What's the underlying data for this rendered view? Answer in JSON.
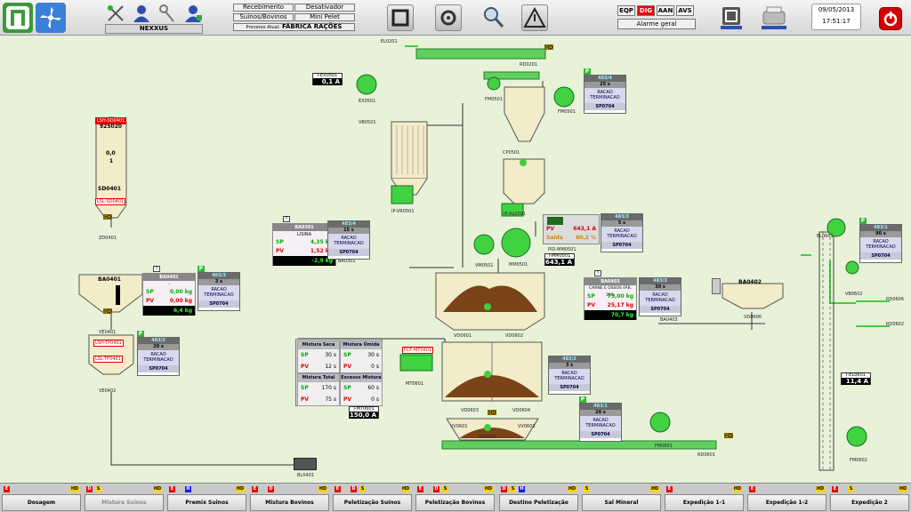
{
  "header": {
    "nexxus_label": "NEXXUS",
    "proc_buttons": [
      "Recebimento",
      "Desativador",
      "Suinos/Bovinos",
      "Mini Pelet"
    ],
    "proc_current_label": "Processo Atual:",
    "proc_current_value": "FÁBRICA RAÇÕES",
    "modes": [
      "EQP",
      "DIG",
      "AAN",
      "AVS"
    ],
    "alarm_label": "Alarme geral",
    "date": "09/05/2013",
    "time": "17:51:17"
  },
  "colors": {
    "machine_green": "#3fcf3f",
    "alarm_red": "#d40000",
    "hd_yellow": "#ffd400",
    "panel_bg": "#e7f2d9"
  },
  "tags": {
    "el0201": "EL0201",
    "rd0201": "RD0201",
    "iex0501": "I-EX0501",
    "iex0501_val": "0,1 A",
    "ex0501": "EX0501",
    "vb0501": "VB0501",
    "fm0501a": "FM0501",
    "fm0501b": "FM0501",
    "cp0501": "CP0501",
    "ipvr0501": "IP-VR0501",
    "ipal0501": "IP-AL0501",
    "vm0501": "VM0501",
    "mm0501": "MM0501",
    "pidmm0501": "PID-MM0501",
    "imm0501": "I-MM0501",
    "imm0501_val": "643,1 A",
    "lshsd0401": "LSH-SD0401",
    "sd_val1": "925020",
    "sd_val2": "0,0",
    "sd_val3": "1",
    "sd0401": "SD0401",
    "lslsd0401": "LSL-SD0401",
    "zd0401": "ZD0401",
    "ba0401_title": "BA0401",
    "ve0401": "VE0401",
    "lshtp0401": "LSH-TP0401",
    "lsltp0401": "LSL-TP0401",
    "ve0402": "VE0402",
    "ba0403_label": "BA0403",
    "ba0402_title": "BA0402",
    "vd0606": "VD0606",
    "el0601": "EL0601",
    "vb0602": "VB0602",
    "rd0606": "RD0606",
    "rd0602": "RD0602",
    "iel0601": "I-EL0601",
    "iel0601_val": "11,4 A",
    "fm0602": "FM0602",
    "vd0601": "VD0601",
    "vd0602": "VD0602",
    "fcfmt0601": "FCF-MT0601",
    "mt0601": "MT0601",
    "vd0603": "VD0603",
    "vd0604": "VD0604",
    "vv0601": "VV0601",
    "vv0602": "VV0602",
    "vv0603": "VV0603",
    "fm0601": "FM0601",
    "rd0601": "RD0601",
    "imt0601": "I-MT0601",
    "imt0601_val": "150,0 A",
    "bl0401": "BL0401",
    "ba0301_label": "BA0301",
    "hd": "HD"
  },
  "recipes": [
    {
      "id": "r1",
      "h1": "483/4",
      "h2": "25 s",
      "h3": "RACAO TERMINACAO",
      "h4": "SP0704"
    },
    {
      "id": "r2",
      "h1": "483/4",
      "h2": "15 s",
      "h3": "RACAO TERMINACAO",
      "h4": "SP0704"
    },
    {
      "id": "r3",
      "h1": "483/3",
      "h2": "5 s",
      "h3": "RACAO TERMINACAO",
      "h4": "SP0704"
    },
    {
      "id": "r4",
      "h1": "483/3",
      "h2": "3 s",
      "h3": "RACAO TERMINACAO",
      "h4": "SP0704"
    },
    {
      "id": "r5",
      "h1": "483/2",
      "h2": "20 s",
      "h3": "RACAO TERMINACAO",
      "h4": "SP0704"
    },
    {
      "id": "r6",
      "h1": "483/3",
      "h2": "30 s",
      "h3": "RACAO TERMINACAO",
      "h4": "SP0704"
    },
    {
      "id": "r7",
      "h1": "483/1",
      "h2": "90 s",
      "h3": "RACAO TERMINACAO",
      "h4": "SP0704"
    },
    {
      "id": "r8",
      "h1": "483/2",
      "h2": "3 s",
      "h3": "RACAO TERMINACAO",
      "h4": "SP0704"
    },
    {
      "id": "r9",
      "h1": "483/1",
      "h2": "20 s",
      "h3": "RACAO TERMINACAO",
      "h4": "SP0704"
    }
  ],
  "dosing": {
    "ba0301": {
      "title": "BA0301",
      "sub": "LISINA",
      "sp_label": "SP",
      "sp": "4,35 kg",
      "pv_label": "PV",
      "pv": "1,52 kg",
      "total": "-2,9 kg"
    },
    "ba0401": {
      "title": "BA0401",
      "sub": "-",
      "sp_label": "SP",
      "sp": "0,00 kg",
      "pv_label": "PV",
      "pv": "0,00 kg",
      "total": "6,4 kg"
    },
    "ba0403": {
      "title": "BA0403",
      "sub": "CARNE E OSSOS FAR. 38%",
      "sp_label": "SP",
      "sp": "75,00 kg",
      "pv_label": "PV",
      "pv": "25,17 kg",
      "total": "70,7 kg"
    }
  },
  "pid": {
    "pv_label": "PV",
    "pv": "643,1 A",
    "saida_label": "Saída",
    "saida": "60,2 %"
  },
  "mix": {
    "seca": {
      "title": "Mistura Seca",
      "sp": "30 s",
      "pv": "12 s"
    },
    "umida": {
      "title": "Mistura Úmida",
      "sp": "30 s",
      "pv": "0 s"
    },
    "total": {
      "title": "Mistura Total",
      "sp": "170 s",
      "pv": "75 s"
    },
    "excesso": {
      "title": "Excesso Mistura",
      "sp": "60 s",
      "pv": "0 s"
    },
    "sp_label": "SP",
    "pv_label": "PV"
  },
  "bottom_buttons": [
    {
      "label": "Dosagem",
      "flags": [
        "E",
        "HD"
      ],
      "disabled": false
    },
    {
      "label": "Mistura Suinos",
      "flags": [
        "D",
        "S",
        "HD"
      ],
      "disabled": true
    },
    {
      "label": "Premix Suinos",
      "flags": [
        "E",
        "H",
        "HD"
      ],
      "disabled": false
    },
    {
      "label": "Mistura Bovinos",
      "flags": [
        "E",
        "D",
        "HD"
      ],
      "disabled": false
    },
    {
      "label": "Peletização Suínos",
      "flags": [
        "E",
        "D",
        "S",
        "HD"
      ],
      "disabled": false
    },
    {
      "label": "Peletização Bovinos",
      "flags": [
        "E",
        "D",
        "S",
        "HD"
      ],
      "disabled": false
    },
    {
      "label": "Destino Peletização",
      "flags": [
        "D",
        "S",
        "H",
        "HD"
      ],
      "disabled": false
    },
    {
      "label": "Sal Mineral",
      "flags": [
        "S",
        "HD"
      ],
      "disabled": false
    },
    {
      "label": "Expedição 1-1",
      "flags": [
        "E",
        "HD"
      ],
      "disabled": false
    },
    {
      "label": "Expedição 1-2",
      "flags": [
        "E",
        "HD"
      ],
      "disabled": false
    },
    {
      "label": "Expedição 2",
      "flags": [
        "E",
        "S",
        "HD"
      ],
      "disabled": false
    }
  ]
}
